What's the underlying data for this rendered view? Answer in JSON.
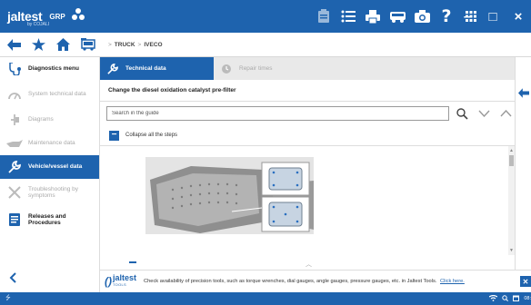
{
  "app": {
    "brand": "jaltest",
    "brand_sub": "by COJALI",
    "group": "GRP"
  },
  "titlebar_icons": [
    "clipboard-icon",
    "list-icon",
    "print-icon",
    "truck-icon",
    "camera-icon",
    "help-icon",
    "grid-icon"
  ],
  "window_controls": {
    "minimize": "–",
    "maximize": "□",
    "close": "×"
  },
  "breadcrumb": [
    "TRUCK",
    "IVECO"
  ],
  "breadcrumb_sep": ">",
  "sidebar": {
    "items": [
      {
        "label": "Diagnostics menu",
        "state": "enabled",
        "icon": "stethoscope-icon"
      },
      {
        "label": "System technical data",
        "state": "disabled",
        "icon": "gauge-icon"
      },
      {
        "label": "Diagrams",
        "state": "disabled",
        "icon": "plug-icon"
      },
      {
        "label": "Maintenance data",
        "state": "disabled",
        "icon": "oil-can-icon"
      },
      {
        "label": "Vehicle/vessel data",
        "state": "active",
        "icon": "wrench-icon"
      },
      {
        "label": "Troubleshooting by symptoms",
        "state": "disabled",
        "icon": "tools-icon"
      },
      {
        "label": "Releases and Procedures",
        "state": "enabled",
        "icon": "document-icon"
      }
    ],
    "collapse": "<"
  },
  "tabs": [
    {
      "label": "Technical data",
      "active": true
    },
    {
      "label": "Repair times",
      "active": false
    }
  ],
  "procedure_title": "Change the diesel oxidation catalyst pre-filter",
  "search": {
    "placeholder": "Search in the guide"
  },
  "collapse_steps_label": "Collapse all the steps",
  "tools_bar": {
    "logo_main": "jaltest",
    "logo_sub": "TOOLS",
    "message": "Check availability of precision tools, such as torque wrenches, dial gauges, angle gauges, pressure gauges, etc. in Jaltest Tools.",
    "link": "Click here.",
    "close": "✕"
  },
  "status": {
    "time": "08:"
  },
  "colors": {
    "primary": "#1e63ae",
    "disabled_text": "#aaaaaa",
    "background": "#f2f2f2"
  }
}
